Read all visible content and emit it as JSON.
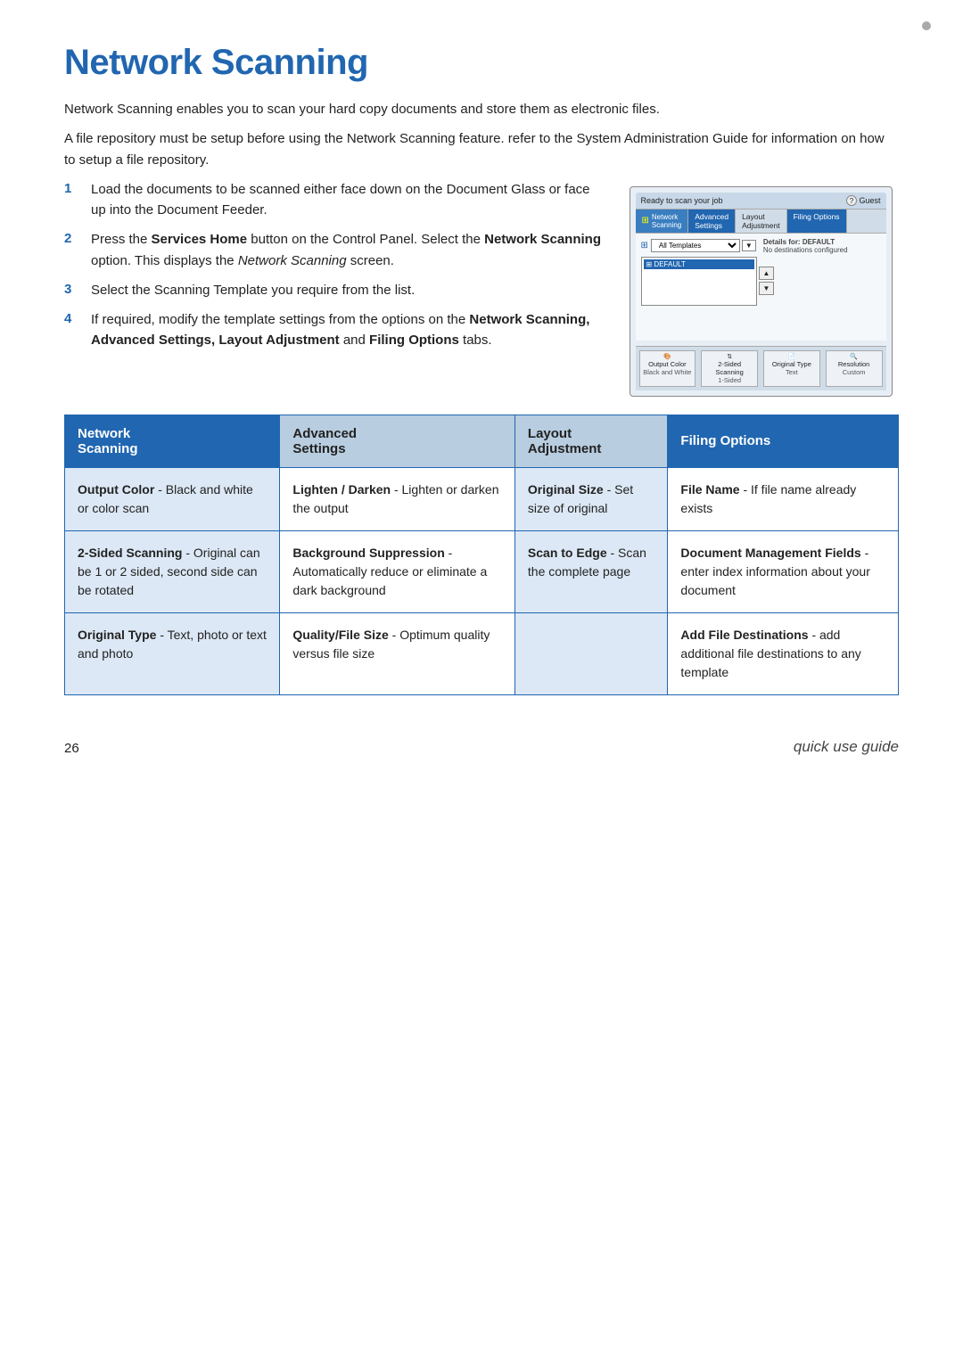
{
  "page": {
    "title": "Network Scanning",
    "intro": [
      "Network Scanning enables you to scan your hard copy documents and store them as electronic files.",
      "A file repository must be setup before using the Network Scanning feature. refer to the System Administration Guide for information on how to setup a file repository."
    ],
    "steps": [
      {
        "num": "1",
        "text": "Load the documents to be scanned either face down on the Document Glass or face up into the Document Feeder."
      },
      {
        "num": "2",
        "text": "Press the <b>Services Home</b> button on the Control Panel. Select the <b>Network Scanning</b> option. This displays the <i>Network Scanning</i> screen."
      },
      {
        "num": "3",
        "text": "Select the Scanning Template you require from the list."
      },
      {
        "num": "4",
        "text": "If required, modify the template settings from the options on the <b>Network Scanning, Advanced Settings, Layout Adjustment</b> and <b>Filing Options</b> tabs."
      }
    ],
    "device": {
      "top_bar_left": "Ready to scan your job",
      "top_bar_right": "Guest",
      "tabs": [
        {
          "label": "Network\nScanning",
          "active": false
        },
        {
          "label": "Advanced\nSettings",
          "active": true
        },
        {
          "label": "Layout\nAdjustment",
          "active": false
        },
        {
          "label": "Filing Options",
          "active": false
        }
      ],
      "select_label": "All Templates",
      "list_item": "DEFAULT",
      "info_title": "Details for: DEFAULT",
      "info_text": "No destinations configured",
      "footer_items": [
        {
          "icon": "Output Color",
          "label": "Black and White"
        },
        {
          "icon": "2-Sided\nScanning",
          "label": "1-Sided"
        },
        {
          "icon": "Original Type",
          "label": "Text"
        },
        {
          "icon": "Resolution",
          "label": "Custom"
        }
      ]
    },
    "table": {
      "headers": [
        {
          "key": "network",
          "label": "Network\nScanning",
          "style": "network"
        },
        {
          "key": "advanced",
          "label": "Advanced\nSettings",
          "style": "advanced"
        },
        {
          "key": "layout",
          "label": "Layout\nAdjustment",
          "style": "layout"
        },
        {
          "key": "filing",
          "label": "Filing Options",
          "style": "filing"
        }
      ],
      "rows": [
        {
          "network": {
            "title": "Output Color",
            "body": " - Black and white or color scan"
          },
          "advanced": {
            "title": "Lighten / Darken",
            "body": " - Lighten or darken the output"
          },
          "layout": {
            "title": "Original Size",
            "body": " - Set size of original"
          },
          "filing": {
            "title": "File Name",
            "body": " - If file name already exists"
          }
        },
        {
          "network": {
            "title": "2-Sided Scanning",
            "body": " - Original can be 1 or 2 sided, second side can be rotated"
          },
          "advanced": {
            "title": "Background Suppression",
            "body": " - Automatically reduce or eliminate a dark background"
          },
          "layout": {
            "title": "Scan to Edge",
            "body": " - Scan the complete page"
          },
          "filing": {
            "title": "Document Management Fields",
            "body": " - enter index information about your document"
          }
        },
        {
          "network": {
            "title": "Original Type",
            "body": " - Text, photo or text and photo"
          },
          "advanced": {
            "title": "Quality/File Size",
            "body": " - Optimum quality versus file size"
          },
          "layout": {
            "title": "",
            "body": ""
          },
          "filing": {
            "title": "Add File Destinations",
            "body": " - add additional file destinations to any template"
          }
        }
      ]
    },
    "footer": {
      "page_number": "26",
      "guide_label": "quick use guide"
    }
  }
}
